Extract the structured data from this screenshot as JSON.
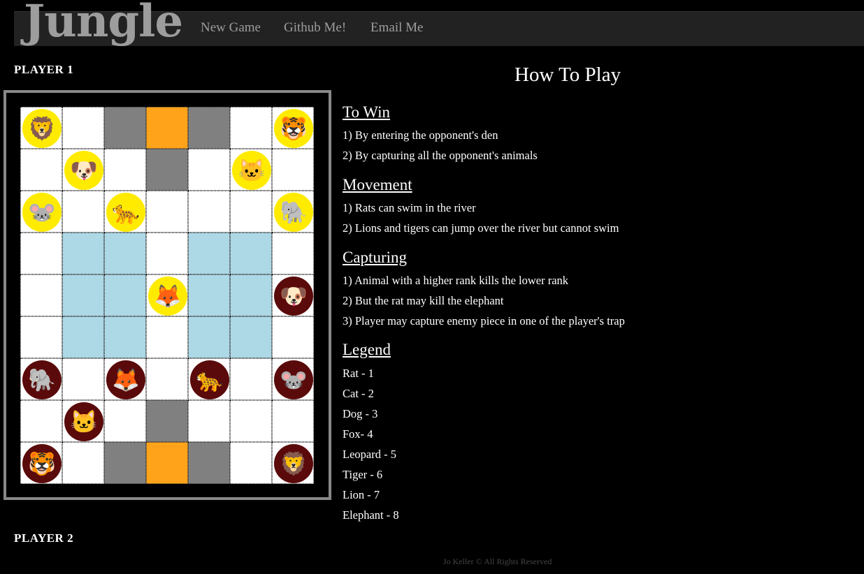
{
  "nav": {
    "brand": "Jungle",
    "links": [
      "New Game",
      "Github Me!",
      "Email Me"
    ]
  },
  "players": {
    "top": "PLAYER 1",
    "bottom": "PLAYER 2"
  },
  "board": {
    "cols": 7,
    "rows": 9,
    "cell_types": [
      [
        "land",
        "land",
        "trap",
        "den",
        "trap",
        "land",
        "land"
      ],
      [
        "land",
        "land",
        "land",
        "trap",
        "land",
        "land",
        "land"
      ],
      [
        "land",
        "land",
        "land",
        "land",
        "land",
        "land",
        "land"
      ],
      [
        "land",
        "water",
        "water",
        "land",
        "water",
        "water",
        "land"
      ],
      [
        "land",
        "water",
        "water",
        "land",
        "water",
        "water",
        "land"
      ],
      [
        "land",
        "water",
        "water",
        "land",
        "water",
        "water",
        "land"
      ],
      [
        "land",
        "land",
        "land",
        "land",
        "land",
        "land",
        "land"
      ],
      [
        "land",
        "land",
        "land",
        "trap",
        "land",
        "land",
        "land"
      ],
      [
        "land",
        "land",
        "trap",
        "den",
        "trap",
        "land",
        "land"
      ]
    ],
    "pieces": [
      {
        "row": 0,
        "col": 0,
        "animal": "lion",
        "player": 1,
        "glyph": "🦁"
      },
      {
        "row": 0,
        "col": 6,
        "animal": "tiger",
        "player": 1,
        "glyph": "🐯"
      },
      {
        "row": 1,
        "col": 1,
        "animal": "dog",
        "player": 1,
        "glyph": "🐶"
      },
      {
        "row": 1,
        "col": 5,
        "animal": "cat",
        "player": 1,
        "glyph": "🐱"
      },
      {
        "row": 2,
        "col": 0,
        "animal": "rat",
        "player": 1,
        "glyph": "🐭"
      },
      {
        "row": 2,
        "col": 2,
        "animal": "leopard",
        "player": 1,
        "glyph": "🐆"
      },
      {
        "row": 2,
        "col": 6,
        "animal": "elephant",
        "player": 1,
        "glyph": "🐘"
      },
      {
        "row": 4,
        "col": 3,
        "animal": "fox",
        "player": 1,
        "glyph": "🦊"
      },
      {
        "row": 4,
        "col": 6,
        "animal": "dog",
        "player": 2,
        "glyph": "🐶"
      },
      {
        "row": 6,
        "col": 0,
        "animal": "elephant",
        "player": 2,
        "glyph": "🐘"
      },
      {
        "row": 6,
        "col": 2,
        "animal": "fox",
        "player": 2,
        "glyph": "🦊"
      },
      {
        "row": 6,
        "col": 4,
        "animal": "leopard",
        "player": 2,
        "glyph": "🐆"
      },
      {
        "row": 6,
        "col": 6,
        "animal": "rat",
        "player": 2,
        "glyph": "🐭"
      },
      {
        "row": 7,
        "col": 1,
        "animal": "cat",
        "player": 2,
        "glyph": "🐱"
      },
      {
        "row": 8,
        "col": 0,
        "animal": "tiger",
        "player": 2,
        "glyph": "🐯"
      },
      {
        "row": 8,
        "col": 6,
        "animal": "lion",
        "player": 2,
        "glyph": "🦁"
      }
    ]
  },
  "howto": {
    "title": "How To Play",
    "sections": {
      "win": {
        "heading": "To Win",
        "rules": [
          "1) By entering the opponent's den",
          "2) By capturing all the opponent's animals"
        ]
      },
      "movement": {
        "heading": "Movement",
        "rules": [
          "1) Rats can swim in the river",
          "2) Lions and tigers can jump over the river but cannot swim"
        ]
      },
      "capturing": {
        "heading": "Capturing",
        "rules": [
          "1) Animal with a higher rank kills the lower rank",
          "2) But the rat may kill the elephant",
          "3) Player may capture enemy piece in one of the player's trap"
        ]
      },
      "legend": {
        "heading": "Legend",
        "items": [
          "Rat - 1",
          "Cat - 2",
          "Dog - 3",
          "Fox- 4",
          "Leopard - 5",
          "Tiger - 6",
          "Lion - 7",
          "Elephant - 8"
        ]
      }
    }
  },
  "footer": "Jo Keller © All Rights Reserved",
  "colors": {
    "water": "#add8e6",
    "trap": "#808080",
    "den": "#ffa31a",
    "player1_bg": "#ffeb00",
    "player2_bg": "#5a0a0a"
  }
}
